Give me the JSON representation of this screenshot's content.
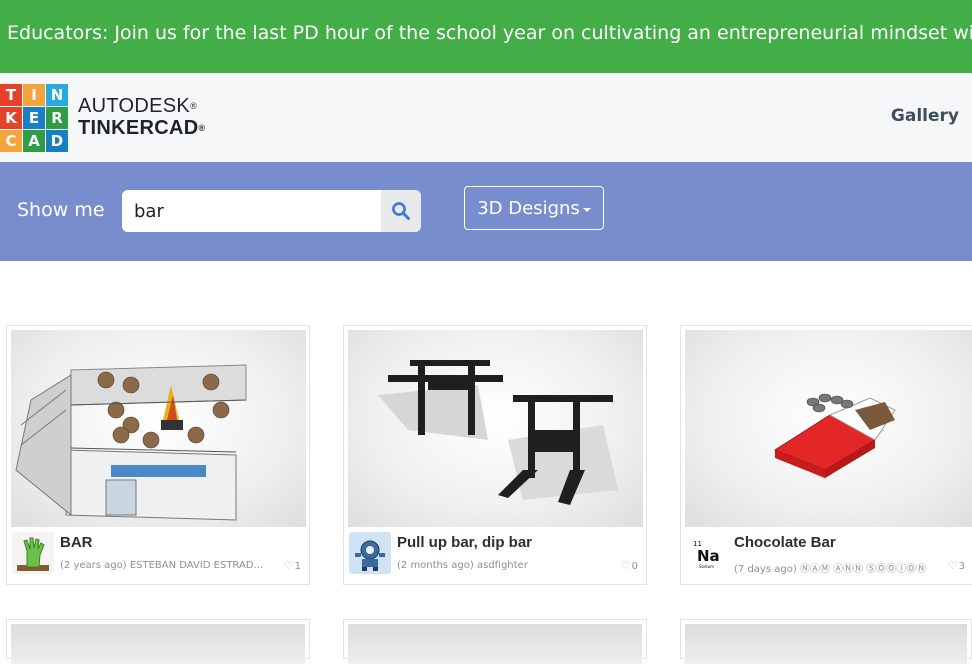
{
  "banner": {
    "text": "Educators: Join us for the last PD hour of the school year on cultivating an entrepreneurial mindset with"
  },
  "header": {
    "logo_letters": [
      "T",
      "I",
      "N",
      "K",
      "E",
      "R",
      "C",
      "A",
      "D"
    ],
    "logo_colors": [
      "#e2432a",
      "#f3a43a",
      "#27a9e1",
      "#e2432a",
      "#1a7ec2",
      "#2f9c46",
      "#f3a43a",
      "#2f9c46",
      "#1a7ec2"
    ],
    "brand_line1": "AUTODESK",
    "brand_line2": "TINKERCAD",
    "nav_gallery": "Gallery"
  },
  "search": {
    "show_me_label": "Show me",
    "query": "bar",
    "filter_label": "3D Designs"
  },
  "results": [
    {
      "title": "BAR",
      "meta": "(2 years ago) ESTEBAN DAVID ESTRADA ...",
      "likes": "1",
      "avatar_icon": "zombie-hand-icon"
    },
    {
      "title": "Pull up bar, dip bar",
      "meta": "(2 months ago) asdfighter",
      "likes": "0",
      "avatar_icon": "robot-icon"
    },
    {
      "title": "Chocolate Bar",
      "meta": "(7 days ago) ⓃⒶⓂ ⒶⓃⓃ ⓈⓄⓄⒾⓄⓃ",
      "likes": "3",
      "avatar_icon": "sodium-element-icon",
      "avatar_text": "Na",
      "avatar_number": "11",
      "avatar_caption": "Sodium"
    }
  ],
  "colors": {
    "banner": "#43ad48",
    "search_band": "#778dcd",
    "header_bg": "#f5f7f8"
  }
}
